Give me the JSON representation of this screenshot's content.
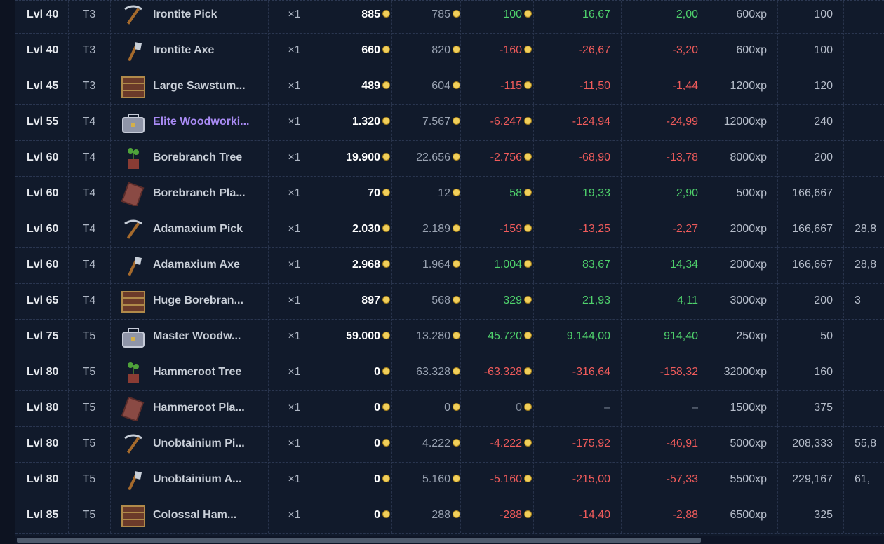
{
  "rows": [
    {
      "lvl": "Lvl 40",
      "tier": "T3",
      "icon": "pickaxe-icon",
      "name": "Irontite Pick",
      "name_color": "normal",
      "qty": "×1",
      "buy": "885",
      "sell": "785",
      "profit": "100",
      "profit_hr": "16,67",
      "profit_xp": "2,00",
      "sign": "pos",
      "xp": "600xp",
      "craft": "100",
      "extra": ""
    },
    {
      "lvl": "Lvl 40",
      "tier": "T3",
      "icon": "axe-icon",
      "name": "Irontite Axe",
      "name_color": "normal",
      "qty": "×1",
      "buy": "660",
      "sell": "820",
      "profit": "-160",
      "profit_hr": "-26,67",
      "profit_xp": "-3,20",
      "sign": "neg",
      "xp": "600xp",
      "craft": "100",
      "extra": ""
    },
    {
      "lvl": "Lvl 45",
      "tier": "T3",
      "icon": "chest-icon",
      "name": "Large Sawstum...",
      "name_color": "normal",
      "qty": "×1",
      "buy": "489",
      "sell": "604",
      "profit": "-115",
      "profit_hr": "-11,50",
      "profit_xp": "-1,44",
      "sign": "neg",
      "xp": "1200xp",
      "craft": "120",
      "extra": ""
    },
    {
      "lvl": "Lvl 55",
      "tier": "T4",
      "icon": "toolbox-icon",
      "name": "Elite Woodworki...",
      "name_color": "purple",
      "qty": "×1",
      "buy": "1.320",
      "sell": "7.567",
      "profit": "-6.247",
      "profit_hr": "-124,94",
      "profit_xp": "-24,99",
      "sign": "neg",
      "xp": "12000xp",
      "craft": "240",
      "extra": ""
    },
    {
      "lvl": "Lvl 60",
      "tier": "T4",
      "icon": "tree-sapling-icon",
      "name": "Borebranch Tree",
      "name_color": "normal",
      "qty": "×1",
      "buy": "19.900",
      "sell": "22.656",
      "profit": "-2.756",
      "profit_hr": "-68,90",
      "profit_xp": "-13,78",
      "sign": "neg",
      "xp": "8000xp",
      "craft": "200",
      "extra": ""
    },
    {
      "lvl": "Lvl 60",
      "tier": "T4",
      "icon": "plank-icon",
      "name": "Borebranch Pla...",
      "name_color": "normal",
      "qty": "×1",
      "buy": "70",
      "sell": "12",
      "profit": "58",
      "profit_hr": "19,33",
      "profit_xp": "2,90",
      "sign": "pos",
      "xp": "500xp",
      "craft": "166,667",
      "extra": ""
    },
    {
      "lvl": "Lvl 60",
      "tier": "T4",
      "icon": "pickaxe-icon",
      "name": "Adamaxium Pick",
      "name_color": "normal",
      "qty": "×1",
      "buy": "2.030",
      "sell": "2.189",
      "profit": "-159",
      "profit_hr": "-13,25",
      "profit_xp": "-2,27",
      "sign": "neg",
      "xp": "2000xp",
      "craft": "166,667",
      "extra": "28,8"
    },
    {
      "lvl": "Lvl 60",
      "tier": "T4",
      "icon": "axe-icon",
      "name": "Adamaxium Axe",
      "name_color": "normal",
      "qty": "×1",
      "buy": "2.968",
      "sell": "1.964",
      "profit": "1.004",
      "profit_hr": "83,67",
      "profit_xp": "14,34",
      "sign": "pos",
      "xp": "2000xp",
      "craft": "166,667",
      "extra": "28,8"
    },
    {
      "lvl": "Lvl 65",
      "tier": "T4",
      "icon": "chest-icon",
      "name": "Huge Borebran...",
      "name_color": "normal",
      "qty": "×1",
      "buy": "897",
      "sell": "568",
      "profit": "329",
      "profit_hr": "21,93",
      "profit_xp": "4,11",
      "sign": "pos",
      "xp": "3000xp",
      "craft": "200",
      "extra": "3"
    },
    {
      "lvl": "Lvl 75",
      "tier": "T5",
      "icon": "toolbox-icon",
      "name": "Master Woodw...",
      "name_color": "normal",
      "qty": "×1",
      "buy": "59.000",
      "sell": "13.280",
      "profit": "45.720",
      "profit_hr": "9.144,00",
      "profit_xp": "914,40",
      "sign": "pos",
      "xp": "250xp",
      "craft": "50",
      "extra": ""
    },
    {
      "lvl": "Lvl 80",
      "tier": "T5",
      "icon": "tree-sapling-icon",
      "name": "Hammeroot Tree",
      "name_color": "normal",
      "qty": "×1",
      "buy": "0",
      "sell": "63.328",
      "profit": "-63.328",
      "profit_hr": "-316,64",
      "profit_xp": "-158,32",
      "sign": "neg",
      "xp": "32000xp",
      "craft": "160",
      "extra": ""
    },
    {
      "lvl": "Lvl 80",
      "tier": "T5",
      "icon": "plank-icon",
      "name": "Hammeroot Pla...",
      "name_color": "normal",
      "qty": "×1",
      "buy": "0",
      "sell": "0",
      "profit": "0",
      "profit_hr": "–",
      "profit_xp": "–",
      "sign": "zero",
      "xp": "1500xp",
      "craft": "375",
      "extra": ""
    },
    {
      "lvl": "Lvl 80",
      "tier": "T5",
      "icon": "pickaxe-icon",
      "name": "Unobtainium Pi...",
      "name_color": "normal",
      "qty": "×1",
      "buy": "0",
      "sell": "4.222",
      "profit": "-4.222",
      "profit_hr": "-175,92",
      "profit_xp": "-46,91",
      "sign": "neg",
      "xp": "5000xp",
      "craft": "208,333",
      "extra": "55,8"
    },
    {
      "lvl": "Lvl 80",
      "tier": "T5",
      "icon": "axe-icon",
      "name": "Unobtainium A...",
      "name_color": "normal",
      "qty": "×1",
      "buy": "0",
      "sell": "5.160",
      "profit": "-5.160",
      "profit_hr": "-215,00",
      "profit_xp": "-57,33",
      "sign": "neg",
      "xp": "5500xp",
      "craft": "229,167",
      "extra": "61,"
    },
    {
      "lvl": "Lvl 85",
      "tier": "T5",
      "icon": "chest-icon",
      "name": "Colossal Ham...",
      "name_color": "normal",
      "qty": "×1",
      "buy": "0",
      "sell": "288",
      "profit": "-288",
      "profit_hr": "-14,40",
      "profit_xp": "-2,88",
      "sign": "neg",
      "xp": "6500xp",
      "craft": "325",
      "extra": ""
    }
  ],
  "colors": {
    "background": "#111a2b",
    "positive": "#4fd16c",
    "negative": "#ef5b5b",
    "rare_name": "#a98bf5",
    "coin": "#f1cf5a"
  }
}
